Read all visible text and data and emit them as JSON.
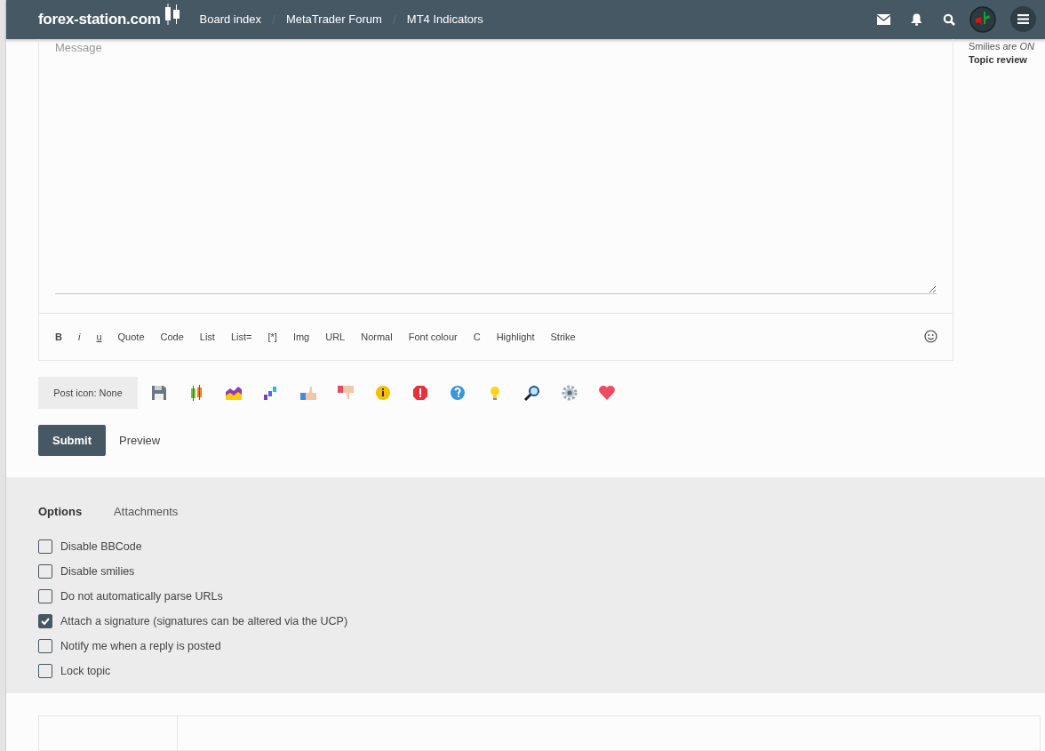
{
  "header": {
    "logo": "forex-station.com",
    "breadcrumbs": [
      "Board index",
      "MetaTrader Forum",
      "MT4 Indicators"
    ]
  },
  "editor": {
    "placeholder": "Message",
    "toolbar": [
      {
        "label": "B",
        "kind": "bold"
      },
      {
        "label": "i",
        "kind": "italic"
      },
      {
        "label": "u",
        "kind": "underline"
      },
      {
        "label": "Quote",
        "kind": "plain"
      },
      {
        "label": "Code",
        "kind": "plain"
      },
      {
        "label": "List",
        "kind": "plain"
      },
      {
        "label": "List=",
        "kind": "plain"
      },
      {
        "label": "[*]",
        "kind": "plain"
      },
      {
        "label": "Img",
        "kind": "plain"
      },
      {
        "label": "URL",
        "kind": "plain"
      },
      {
        "label": "Normal",
        "kind": "plain"
      },
      {
        "label": "Font colour",
        "kind": "plain"
      },
      {
        "label": "C",
        "kind": "plain"
      },
      {
        "label": "Highlight",
        "kind": "plain"
      },
      {
        "label": "Strike",
        "kind": "plain"
      }
    ]
  },
  "post_icon": {
    "label": "Post icon: None"
  },
  "actions": {
    "submit": "Submit",
    "preview": "Preview"
  },
  "sidebar": {
    "smilies": "Smilies are *ON*",
    "topic_review": "Topic review"
  },
  "options": {
    "tabs": [
      {
        "label": "Options",
        "selected": true
      },
      {
        "label": "Attachments",
        "selected": false
      }
    ],
    "checkboxes": [
      {
        "label": "Disable BBCode",
        "checked": false
      },
      {
        "label": "Disable smilies",
        "checked": false
      },
      {
        "label": "Do not automatically parse URLs",
        "checked": false
      },
      {
        "label": "Attach a signature (signatures can be altered via the UCP)",
        "checked": true
      },
      {
        "label": "Notify me when a reply is posted",
        "checked": false
      },
      {
        "label": "Lock topic",
        "checked": false
      }
    ]
  }
}
